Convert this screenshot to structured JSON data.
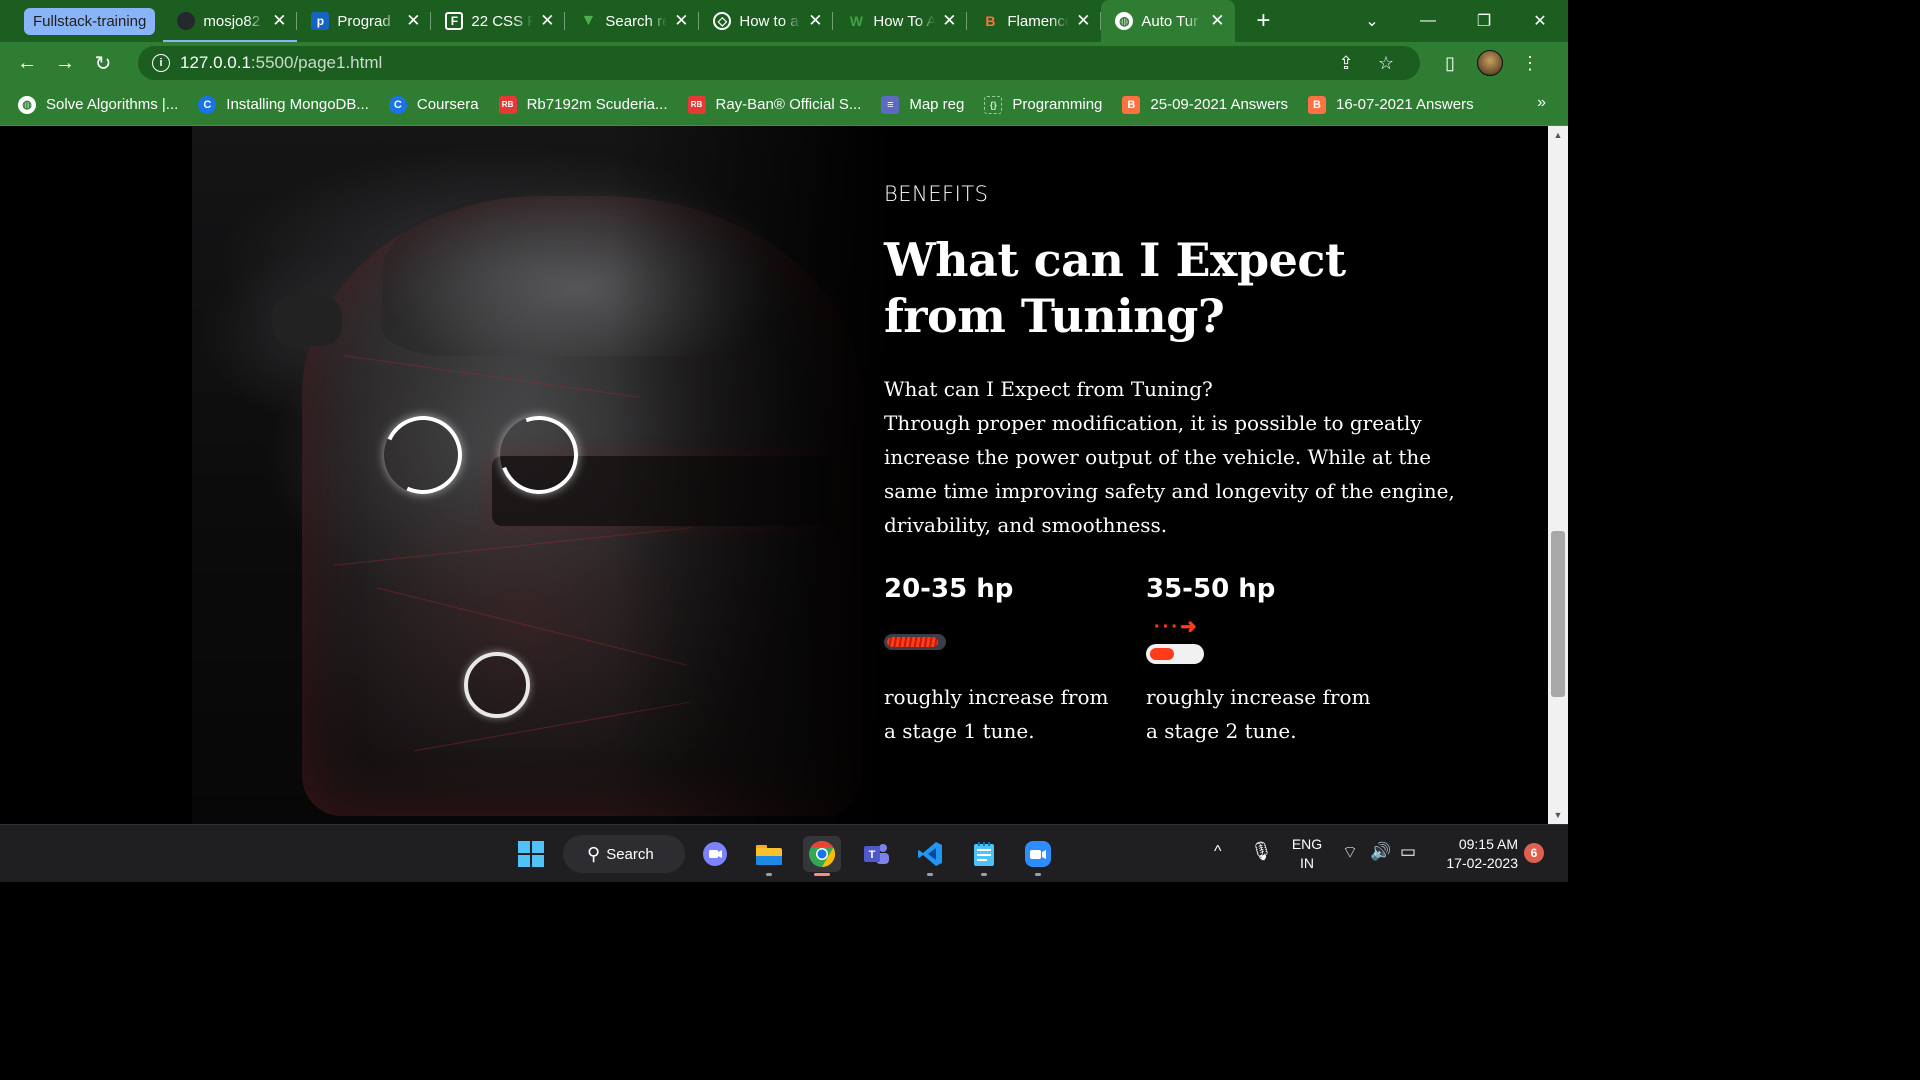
{
  "tab_group": {
    "label": "Fullstack-training"
  },
  "tabs": [
    {
      "label": "mosjo82",
      "icon": "github-icon",
      "close": "✕"
    },
    {
      "label": "Prograd",
      "icon": "prograd-icon",
      "close": "✕"
    },
    {
      "label": "22 CSS P",
      "icon": "f-box-icon",
      "close": "✕"
    },
    {
      "label": "Search re",
      "icon": "vuetify-icon",
      "close": "✕"
    },
    {
      "label": "How to a",
      "icon": "codepen-icon",
      "close": "✕"
    },
    {
      "label": "How To A",
      "icon": "w-icon",
      "close": "✕"
    },
    {
      "label": "Flamenco",
      "icon": "flamenco-icon",
      "close": "✕"
    },
    {
      "label": "Auto Tur",
      "icon": "globe-icon",
      "close": "✕"
    }
  ],
  "toolbar": {
    "back": "←",
    "forward": "→",
    "reload": "↻",
    "info": "i",
    "url_host": "127.0.0.1",
    "url_rest": ":5500/page1.html"
  },
  "bookmarks": [
    {
      "label": "Solve Algorithms |...",
      "color": "#ffffff"
    },
    {
      "label": "Installing MongoDB...",
      "color": "#1a73e8"
    },
    {
      "label": "Coursera",
      "color": "#1a73e8"
    },
    {
      "label": "Rb7192m Scuderia...",
      "color": "#e53935"
    },
    {
      "label": "Ray-Ban® Official S...",
      "color": "#e53935"
    },
    {
      "label": "Map reg",
      "color": "#5c6bc0"
    },
    {
      "label": "Programming",
      "color": "#3e6b3f"
    },
    {
      "label": "25-09-2021 Answers",
      "color": "#ff7043"
    },
    {
      "label": "16-07-2021 Answers",
      "color": "#ff7043"
    }
  ],
  "bookmarks_more": "»",
  "page": {
    "eyebrow": "BENEFITS",
    "headline": "What can I Expect from Tuning?",
    "body_line1": "What can I Expect from Tuning?",
    "body_line2": "Through proper modification, it is possible to greatly increase the power output of the vehicle. While at the same time improving safety and longevity of the engine, drivability, and smoothness.",
    "stats": [
      {
        "value": "20-35 hp",
        "desc": "roughly increase from a stage 1 tune.",
        "level": 0.95
      },
      {
        "value": "35-50 hp",
        "desc": "roughly increase from a stage 2 tune.",
        "level": 0.55
      }
    ],
    "arrow": "···➜"
  },
  "scrollbar": {
    "position": 0.78,
    "visible_fraction": 0.25
  },
  "taskbar": {
    "search_label": "Search",
    "apps": [
      {
        "name": "start-button-icon",
        "glyph": "⊞",
        "color": "#4fc3f7"
      },
      {
        "name": "meet-icon",
        "glyph": "▶",
        "color": "#7c83ff"
      },
      {
        "name": "file-explorer-icon",
        "glyph": "▬",
        "color": "#fbc02d"
      },
      {
        "name": "chrome-icon",
        "glyph": "◉",
        "color": "#ea4335"
      },
      {
        "name": "teams-icon",
        "glyph": "T",
        "color": "#6264a7"
      },
      {
        "name": "vscode-icon",
        "glyph": "⌥",
        "color": "#2196f3"
      },
      {
        "name": "notepad-icon",
        "glyph": "≡",
        "color": "#4fc3f7"
      },
      {
        "name": "zoom-icon",
        "glyph": "■",
        "color": "#2d8cff"
      }
    ],
    "lang_line1": "ENG",
    "lang_line2": "IN",
    "time": "09:15 AM",
    "date": "17-02-2023",
    "notifications": "6"
  }
}
